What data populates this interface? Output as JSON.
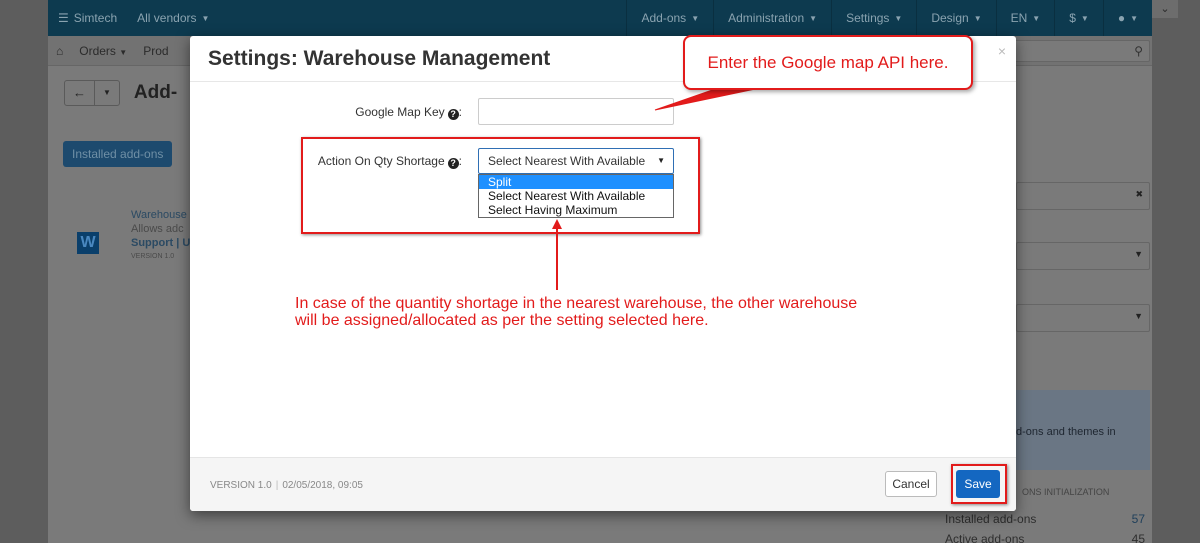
{
  "background": {
    "topbar": {
      "brand": "Simtech",
      "vendors": "All vendors",
      "menu": [
        "Add-ons",
        "Administration",
        "Settings",
        "Design",
        "EN",
        "$"
      ]
    },
    "navbar": {
      "orders": "Orders",
      "products": "Prod"
    },
    "page_title": "Add-",
    "installed_tab": "Installed add-ons",
    "addon": {
      "name": "Warehouse",
      "desc": "Allows adc",
      "links": "Support | U",
      "version": "VERSION 1.0"
    },
    "side": {
      "promo": "d-ons and themes in",
      "init": "ONS INITIALIZATION",
      "installed_label": "Installed add-ons",
      "installed_count": "57",
      "active_label": "Active add-ons",
      "active_count": "45"
    }
  },
  "modal": {
    "title": "Settings: Warehouse Management",
    "close": "×",
    "fields": {
      "google_map_key_label": "Google Map Key",
      "google_map_key_value": "",
      "qty_shortage_label": "Action On Qty Shortage",
      "qty_shortage_selected": "Select Nearest With Available",
      "qty_shortage_options": [
        "Split",
        "Select Nearest With Available",
        "Select Having Maximum"
      ]
    },
    "footer": {
      "version": "VERSION 1.0",
      "date": "02/05/2018, 09:05",
      "cancel": "Cancel",
      "save": "Save"
    }
  },
  "annotations": {
    "callout": "Enter the Google map API here.",
    "note_line1": "In case of the quantity shortage in the nearest warehouse, the other warehouse",
    "note_line2": "will be assigned/allocated as per the setting selected here.",
    "color": "#e21b1b"
  }
}
